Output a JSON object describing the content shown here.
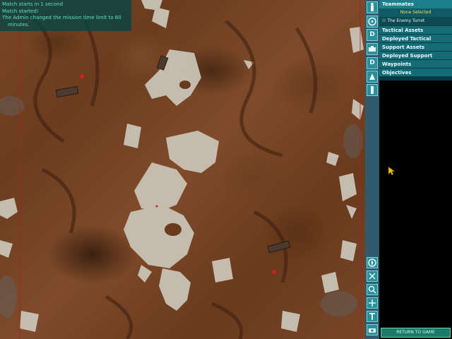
{
  "chat": {
    "lines": [
      "Match starts in 1 second",
      "Match started!",
      "The Admin changed the mission time limit to 60",
      "minutes."
    ]
  },
  "side_icons_top": [
    "D",
    "D"
  ],
  "panel": {
    "teammates_header": "Teammates",
    "none_selected": "None Selected",
    "enemy_turret": "The Enemy Turret",
    "items": [
      "Tactical Assets",
      "Deployed Tactical",
      "Support Assets",
      "Deployed Support",
      "Waypoints",
      "Objectives"
    ]
  },
  "return_button": "RETURN TO GAME",
  "colors": {
    "panel_header": "#1d7f8a",
    "panel_bg": "#003a42",
    "chat_text": "#5ee0c0",
    "selected_text": "#f2e35a"
  }
}
